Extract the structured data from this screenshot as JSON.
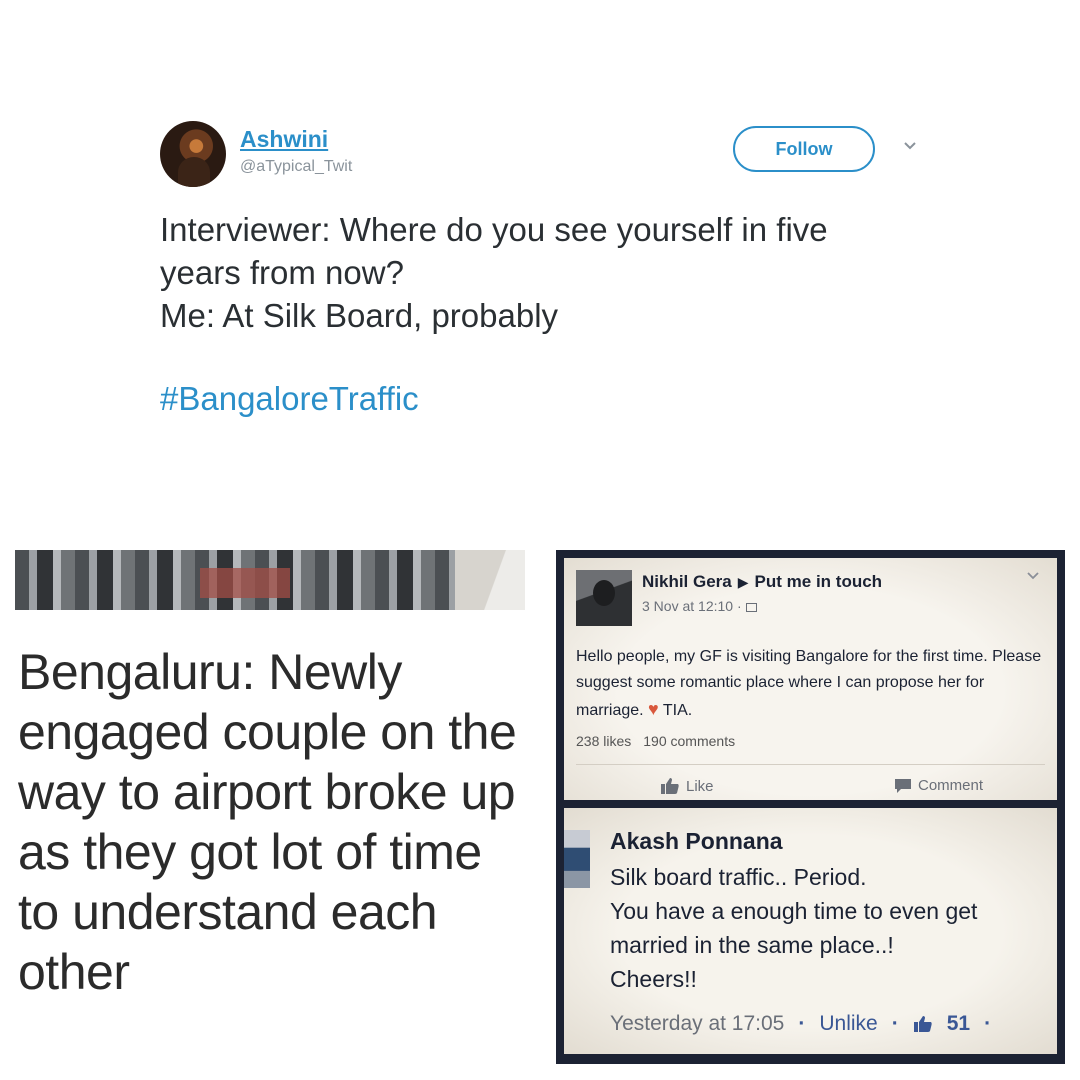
{
  "tweet": {
    "name": "Ashwini",
    "handle": "@aTypical_Twit",
    "follow_label": "Follow",
    "lines": [
      "Interviewer: Where do you see yourself in five",
      "years from now?",
      "Me: At Silk Board, probably"
    ],
    "hashtag": "#BangaloreTraffic"
  },
  "news": {
    "headline": "Bengaluru: Newly engaged couple on the way to airport broke up as they got lot of time to understand each other"
  },
  "facebook": {
    "post": {
      "author": "Nikhil Gera",
      "target": "Put me in touch",
      "meta": "3 Nov at 12:10 ·",
      "body": "Hello people, my GF is visiting Bangalore for the first time. Please suggest some romantic place where I can propose her for marriage.",
      "body_end": "TIA.",
      "likes": "238 likes",
      "comments": "190 comments",
      "like_label": "Like",
      "comment_label": "Comment"
    },
    "reply": {
      "author": "Akash Ponnana",
      "lines": [
        "Silk board traffic.. Period.",
        "You have a enough time to even get",
        "married in the same place..!",
        "Cheers!!"
      ],
      "time": "Yesterday at 17:05",
      "unlike_label": "Unlike",
      "like_count": "51"
    }
  }
}
